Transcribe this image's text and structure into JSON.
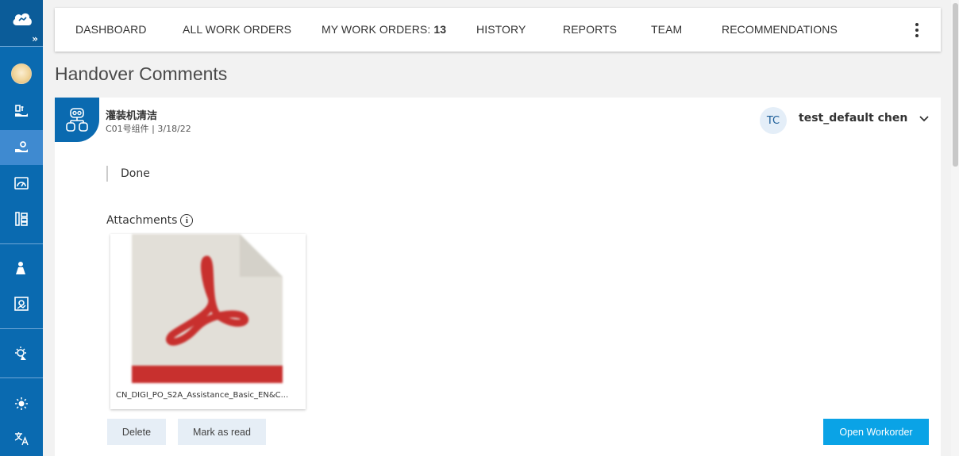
{
  "sidebar": {
    "expand_glyph": "»",
    "items": [
      {
        "name": "cloud-logo-icon"
      },
      {
        "name": "user-avatar"
      },
      {
        "name": "hand-tools-icon"
      },
      {
        "name": "hand-gear-icon",
        "active": true
      },
      {
        "name": "gauge-icon"
      },
      {
        "name": "hierarchy-icon"
      },
      {
        "name": "person-tool-icon"
      },
      {
        "name": "image-settings-icon"
      },
      {
        "name": "lightbulb-icon"
      },
      {
        "name": "brightness-icon"
      },
      {
        "name": "translate-icon"
      }
    ],
    "accent_color": "#0a6ab0",
    "active_color": "#3f8ad0"
  },
  "nav": {
    "tabs": [
      {
        "label": "DASHBOARD"
      },
      {
        "label": "ALL WORK ORDERS"
      },
      {
        "label": "MY WORK ORDERS: ",
        "count": "13"
      },
      {
        "label": "HISTORY"
      },
      {
        "label": "REPORTS"
      },
      {
        "label": "TEAM"
      },
      {
        "label": "RECOMMENDATIONS"
      }
    ],
    "more_icon": "kebab-menu-icon"
  },
  "page": {
    "title": "Handover Comments"
  },
  "card": {
    "workorder_title": "灌装机清洁",
    "workorder_sub": "C01号组件 | 3/18/22",
    "assignee_initials": "TC",
    "assignee_name": "test_default chen",
    "comment": "Done",
    "attachments_label": "Attachments",
    "attachment": {
      "filename": "CN_DIGI_PO_S2A_Assistance_Basic_EN&C...",
      "icon": "pdf-file-icon"
    },
    "buttons": {
      "delete": "Delete",
      "mark_read": "Mark as read",
      "open_workorder": "Open Workorder"
    },
    "primary_color": "#0aa3e6"
  }
}
